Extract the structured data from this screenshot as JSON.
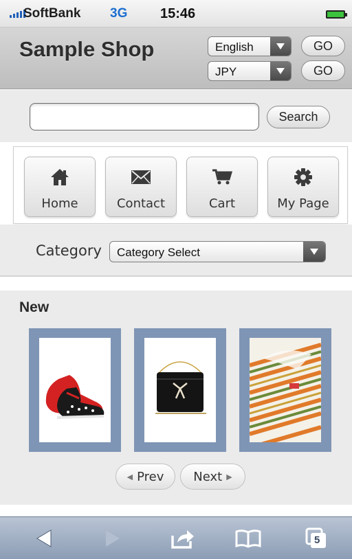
{
  "status_bar": {
    "carrier": "SoftBank",
    "network": "3G",
    "time": "15:46"
  },
  "header": {
    "title": "Sample Shop",
    "language_select": "English",
    "currency_select": "JPY",
    "go_label": "GO"
  },
  "search": {
    "value": "",
    "placeholder": "",
    "button_label": "Search"
  },
  "nav": [
    {
      "label": "Home",
      "icon": "home-icon"
    },
    {
      "label": "Contact",
      "icon": "mail-icon"
    },
    {
      "label": "Cart",
      "icon": "cart-icon"
    },
    {
      "label": "My Page",
      "icon": "gear-icon"
    }
  ],
  "category": {
    "label": "Category",
    "selected": "Category Select"
  },
  "new_items": {
    "title": "New",
    "products": [
      {
        "image": "red-shoes-image"
      },
      {
        "image": "black-handbag-image"
      },
      {
        "image": "striped-shirt-image"
      }
    ],
    "prev_label": "Prev",
    "next_label": "Next"
  },
  "toolbar": {
    "tabs_count": "5",
    "icons": [
      "back-icon",
      "forward-icon",
      "share-icon",
      "bookmarks-icon",
      "tabs-icon"
    ]
  },
  "colors": {
    "header_bg": "#c9c9c9",
    "product_frame": "#7f95b5",
    "toolbar_bg": "#a3b1c5",
    "network_blue": "#1d6fd0"
  }
}
